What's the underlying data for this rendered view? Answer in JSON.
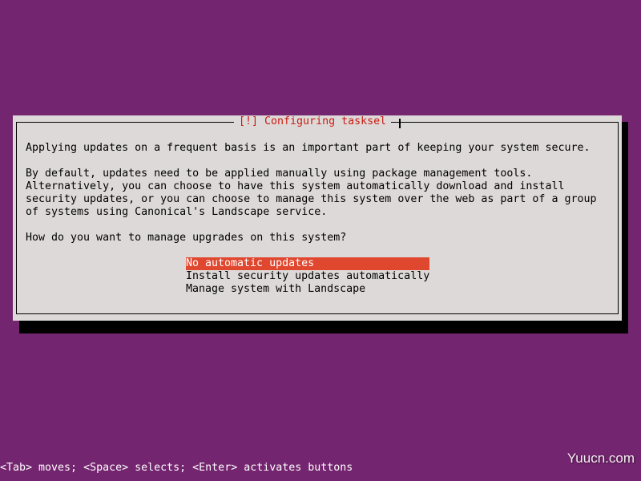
{
  "dialog": {
    "title": "[!] Configuring tasksel",
    "paragraph1": "Applying updates on a frequent basis is an important part of keeping your system secure.",
    "paragraph2_lines": [
      "By default, updates need to be applied manually using package management tools.",
      "Alternatively, you can choose to have this system automatically download and install",
      "security updates, or you can choose to manage this system over the web as part of a group",
      "of systems using Canonical's Landscape service."
    ],
    "question": "How do you want to manage upgrades on this system?",
    "options": [
      {
        "label": "No automatic updates",
        "selected": true
      },
      {
        "label": "Install security updates automatically",
        "selected": false
      },
      {
        "label": "Manage system with Landscape",
        "selected": false
      }
    ]
  },
  "help_bar": {
    "text": "<Tab> moves; <Space> selects; <Enter> activates buttons"
  },
  "watermark": {
    "text": "Yuucn.com"
  },
  "colors": {
    "background": "#74256f",
    "dialog_bg": "#ded9d9",
    "title_text": "#c91c0f",
    "selection_bg": "#e0472f",
    "shadow": "#000000"
  }
}
